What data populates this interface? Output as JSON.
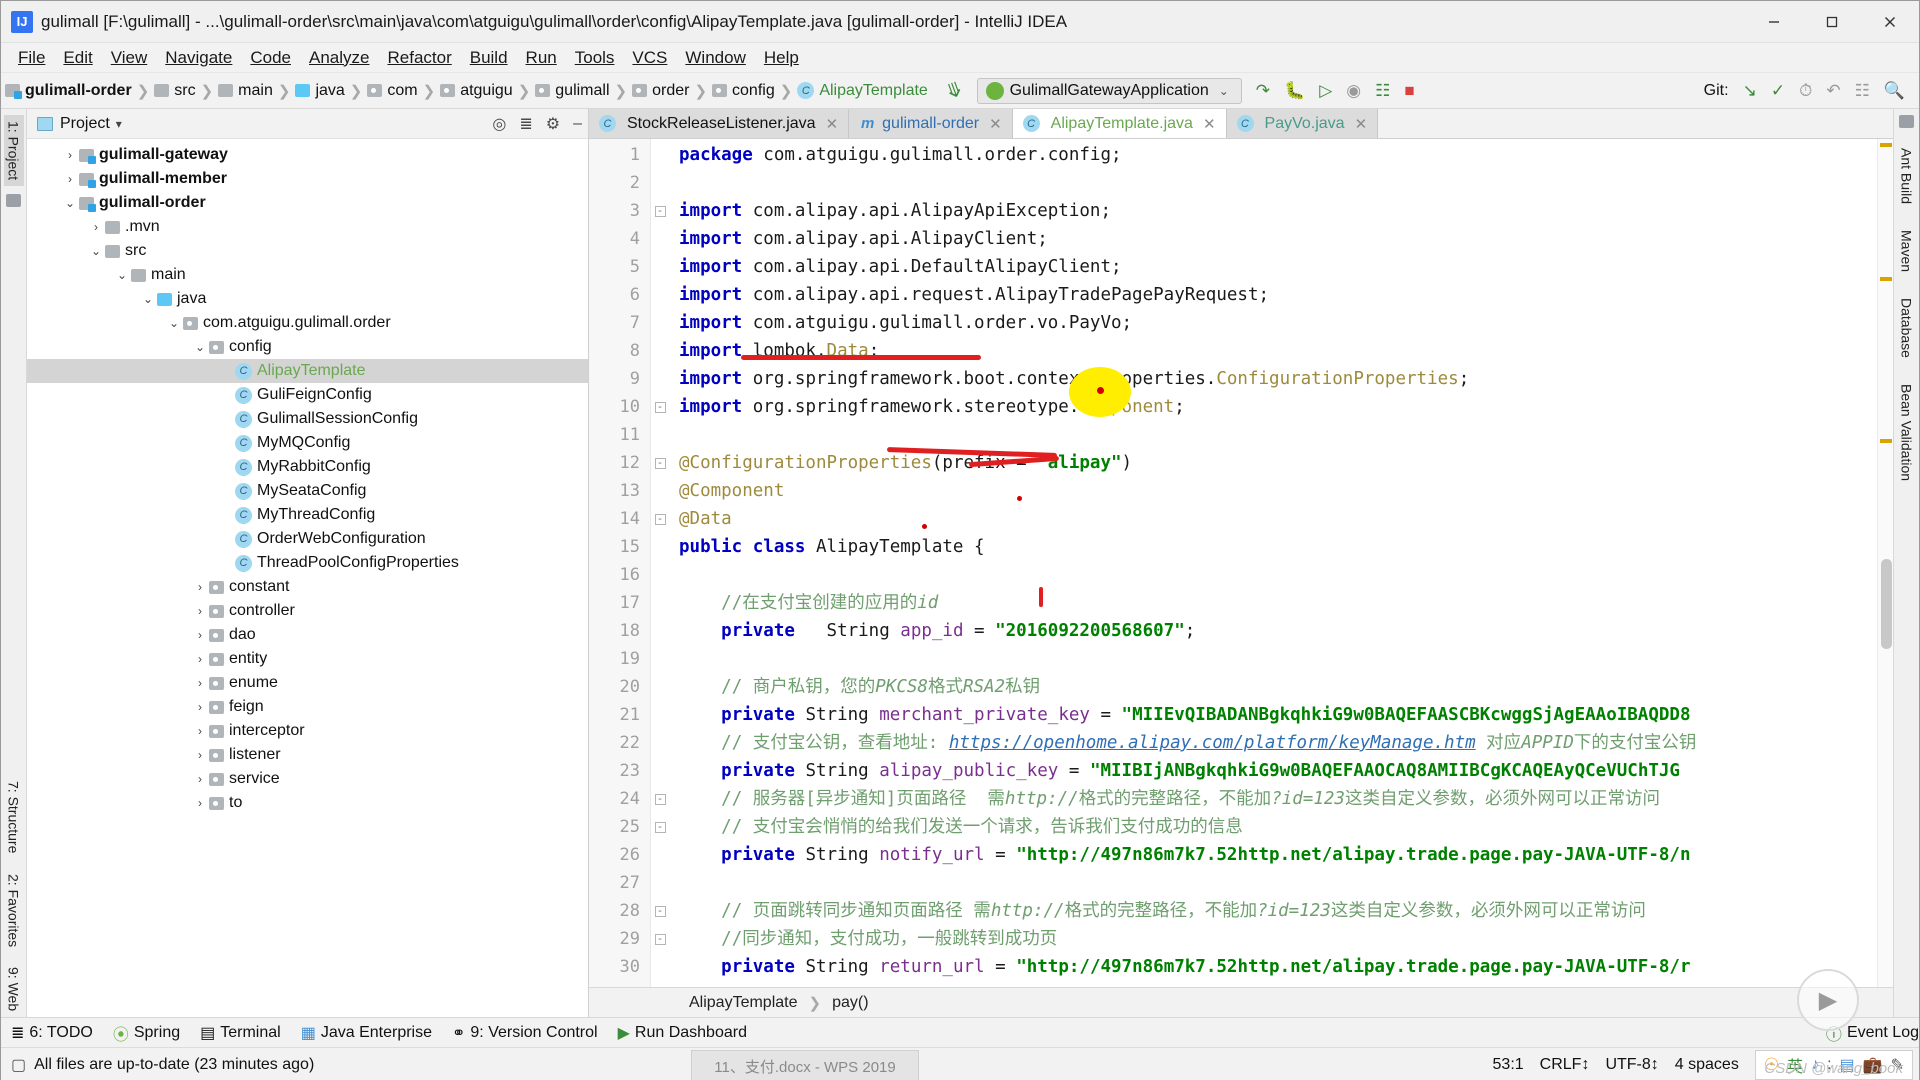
{
  "window": {
    "app_icon": "IJ",
    "title": "gulimall [F:\\gulimall] - ...\\gulimall-order\\src\\main\\java\\com\\atguigu\\gulimall\\order\\config\\AlipayTemplate.java [gulimall-order] - IntelliJ IDEA",
    "minimize": "—",
    "maximize": "❐",
    "close": "✕"
  },
  "menubar": [
    "File",
    "Edit",
    "View",
    "Navigate",
    "Code",
    "Analyze",
    "Refactor",
    "Build",
    "Run",
    "Tools",
    "VCS",
    "Window",
    "Help"
  ],
  "breadcrumb": [
    {
      "label": "gulimall-order",
      "icon": "module-folder-icon",
      "style": "bold"
    },
    {
      "label": "src",
      "icon": "folder-icon",
      "style": "plain"
    },
    {
      "label": "main",
      "icon": "folder-icon",
      "style": "plain"
    },
    {
      "label": "java",
      "icon": "source-folder-icon",
      "style": "plain"
    },
    {
      "label": "com",
      "icon": "package-icon",
      "style": "plain"
    },
    {
      "label": "atguigu",
      "icon": "package-icon",
      "style": "plain"
    },
    {
      "label": "gulimall",
      "icon": "package-icon",
      "style": "plain"
    },
    {
      "label": "order",
      "icon": "package-icon",
      "style": "plain"
    },
    {
      "label": "config",
      "icon": "package-icon",
      "style": "plain"
    },
    {
      "label": "AlipayTemplate",
      "icon": "class-icon",
      "style": "green"
    }
  ],
  "run_config": {
    "name": "GulimallGatewayApplication",
    "chevron": "⌄",
    "tools": [
      "rerun-icon",
      "debug-icon",
      "run-with-coverage-icon",
      "profiler-icon",
      "attach-debugger-icon",
      "stop-icon"
    ]
  },
  "git_section": {
    "label": "Git:",
    "icons": [
      "update-project-icon",
      "commit-icon",
      "history-icon",
      "rollback-icon",
      "ide-settings-icon",
      "search-everywhere-icon"
    ]
  },
  "left_strip": [
    {
      "label": "1: Project",
      "selected": true
    },
    {
      "label": "structure-tool-icon",
      "selected": false
    }
  ],
  "left_strip_bottom": [
    {
      "label": "7: Structure"
    },
    {
      "label": "2: Favorites"
    },
    {
      "label": "9: Web"
    }
  ],
  "right_strip": [
    "Ant Build",
    "Maven",
    "Database",
    "Bean Validation"
  ],
  "project_panel": {
    "title": "Project",
    "dropdown": "▾",
    "tools": [
      "locate-icon",
      "collapse-all-icon",
      "settings-icon",
      "hide-icon"
    ],
    "tree": [
      {
        "indent": 1,
        "chevron": "›",
        "icon": "module-folder-icon",
        "label": "gulimall-gateway",
        "bold": true,
        "selected": false
      },
      {
        "indent": 1,
        "chevron": "›",
        "icon": "module-folder-icon",
        "label": "gulimall-member",
        "bold": true,
        "selected": false
      },
      {
        "indent": 1,
        "chevron": "⌄",
        "icon": "module-folder-icon",
        "label": "gulimall-order",
        "bold": true,
        "selected": false
      },
      {
        "indent": 2,
        "chevron": "›",
        "icon": "folder-icon",
        "label": ".mvn",
        "bold": false,
        "selected": false
      },
      {
        "indent": 2,
        "chevron": "⌄",
        "icon": "folder-icon",
        "label": "src",
        "bold": false,
        "selected": false
      },
      {
        "indent": 3,
        "chevron": "⌄",
        "icon": "folder-icon",
        "label": "main",
        "bold": false,
        "selected": false
      },
      {
        "indent": 4,
        "chevron": "⌄",
        "icon": "source-folder-icon",
        "label": "java",
        "bold": false,
        "selected": false
      },
      {
        "indent": 5,
        "chevron": "⌄",
        "icon": "package-icon",
        "label": "com.atguigu.gulimall.order",
        "bold": false,
        "selected": false
      },
      {
        "indent": 6,
        "chevron": "⌄",
        "icon": "package-icon",
        "label": "config",
        "bold": false,
        "selected": false
      },
      {
        "indent": 7,
        "chevron": "",
        "icon": "class-icon",
        "label": "AlipayTemplate",
        "bold": false,
        "selected": true,
        "green": true
      },
      {
        "indent": 7,
        "chevron": "",
        "icon": "class-icon",
        "label": "GuliFeignConfig",
        "bold": false,
        "selected": false
      },
      {
        "indent": 7,
        "chevron": "",
        "icon": "class-icon",
        "label": "GulimallSessionConfig",
        "bold": false,
        "selected": false
      },
      {
        "indent": 7,
        "chevron": "",
        "icon": "class-icon",
        "label": "MyMQConfig",
        "bold": false,
        "selected": false
      },
      {
        "indent": 7,
        "chevron": "",
        "icon": "class-icon",
        "label": "MyRabbitConfig",
        "bold": false,
        "selected": false
      },
      {
        "indent": 7,
        "chevron": "",
        "icon": "class-icon",
        "label": "MySeataConfig",
        "bold": false,
        "selected": false
      },
      {
        "indent": 7,
        "chevron": "",
        "icon": "class-icon",
        "label": "MyThreadConfig",
        "bold": false,
        "selected": false
      },
      {
        "indent": 7,
        "chevron": "",
        "icon": "class-icon",
        "label": "OrderWebConfiguration",
        "bold": false,
        "selected": false
      },
      {
        "indent": 7,
        "chevron": "",
        "icon": "class-icon",
        "label": "ThreadPoolConfigProperties",
        "bold": false,
        "selected": false
      },
      {
        "indent": 6,
        "chevron": "›",
        "icon": "package-icon",
        "label": "constant",
        "bold": false,
        "selected": false
      },
      {
        "indent": 6,
        "chevron": "›",
        "icon": "package-icon",
        "label": "controller",
        "bold": false,
        "selected": false
      },
      {
        "indent": 6,
        "chevron": "›",
        "icon": "package-icon",
        "label": "dao",
        "bold": false,
        "selected": false
      },
      {
        "indent": 6,
        "chevron": "›",
        "icon": "package-icon",
        "label": "entity",
        "bold": false,
        "selected": false
      },
      {
        "indent": 6,
        "chevron": "›",
        "icon": "package-icon",
        "label": "enume",
        "bold": false,
        "selected": false
      },
      {
        "indent": 6,
        "chevron": "›",
        "icon": "package-icon",
        "label": "feign",
        "bold": false,
        "selected": false
      },
      {
        "indent": 6,
        "chevron": "›",
        "icon": "package-icon",
        "label": "interceptor",
        "bold": false,
        "selected": false
      },
      {
        "indent": 6,
        "chevron": "›",
        "icon": "package-icon",
        "label": "listener",
        "bold": false,
        "selected": false
      },
      {
        "indent": 6,
        "chevron": "›",
        "icon": "package-icon",
        "label": "service",
        "bold": false,
        "selected": false
      },
      {
        "indent": 6,
        "chevron": "›",
        "icon": "package-icon",
        "label": "to",
        "bold": false,
        "selected": false
      }
    ]
  },
  "editor_tabs": [
    {
      "label": "StockReleaseListener.java",
      "icon": "class-icon",
      "color": "plain",
      "active": false,
      "close": "✕"
    },
    {
      "label": "gulimall-order",
      "icon": "maven-icon",
      "color": "blue",
      "active": false,
      "close": "✕"
    },
    {
      "label": "AlipayTemplate.java",
      "icon": "class-icon",
      "color": "green",
      "active": true,
      "close": "✕"
    },
    {
      "label": "PayVo.java",
      "icon": "class-icon",
      "color": "teal",
      "active": false,
      "close": "✕"
    }
  ],
  "code": {
    "first_line_number": 1,
    "lines": [
      {
        "n": 1,
        "fold": "",
        "tokens": [
          {
            "t": "package ",
            "c": "kw"
          },
          {
            "t": "com.atguigu.gulimall.order.config;",
            "c": "pln"
          }
        ]
      },
      {
        "n": 2,
        "fold": "",
        "tokens": []
      },
      {
        "n": 3,
        "fold": "-",
        "tokens": [
          {
            "t": "import ",
            "c": "kw"
          },
          {
            "t": "com.alipay.api.AlipayApiException;",
            "c": "pln"
          }
        ]
      },
      {
        "n": 4,
        "fold": "",
        "tokens": [
          {
            "t": "import ",
            "c": "kw"
          },
          {
            "t": "com.alipay.api.AlipayClient;",
            "c": "pln"
          }
        ]
      },
      {
        "n": 5,
        "fold": "",
        "tokens": [
          {
            "t": "import ",
            "c": "kw"
          },
          {
            "t": "com.alipay.api.DefaultAlipayClient;",
            "c": "pln"
          }
        ]
      },
      {
        "n": 6,
        "fold": "",
        "tokens": [
          {
            "t": "import ",
            "c": "kw"
          },
          {
            "t": "com.alipay.api.request.AlipayTradePagePayRequest;",
            "c": "pln"
          }
        ]
      },
      {
        "n": 7,
        "fold": "",
        "tokens": [
          {
            "t": "import ",
            "c": "kw"
          },
          {
            "t": "com.atguigu.gulimall.order.vo.PayVo;",
            "c": "pln"
          }
        ]
      },
      {
        "n": 8,
        "fold": "",
        "tokens": [
          {
            "t": "import ",
            "c": "kw"
          },
          {
            "t": "lombok.",
            "c": "pln"
          },
          {
            "t": "Data",
            "c": "ann"
          },
          {
            "t": ";",
            "c": "pln"
          }
        ]
      },
      {
        "n": 9,
        "fold": "",
        "tokens": [
          {
            "t": "import ",
            "c": "kw"
          },
          {
            "t": "org.springframework.boot.context.properties.",
            "c": "pln"
          },
          {
            "t": "ConfigurationProperties",
            "c": "ann"
          },
          {
            "t": ";",
            "c": "pln"
          }
        ]
      },
      {
        "n": 10,
        "fold": "-",
        "tokens": [
          {
            "t": "import ",
            "c": "kw"
          },
          {
            "t": "org.springframework.stereotype.",
            "c": "pln"
          },
          {
            "t": "Component",
            "c": "ann"
          },
          {
            "t": ";",
            "c": "pln"
          }
        ]
      },
      {
        "n": 11,
        "fold": "",
        "tokens": []
      },
      {
        "n": 12,
        "fold": "-",
        "tokens": [
          {
            "t": "@ConfigurationProperties",
            "c": "ann"
          },
          {
            "t": "(prefix = ",
            "c": "pln"
          },
          {
            "t": "\"alipay\"",
            "c": "str"
          },
          {
            "t": ")",
            "c": "pln"
          }
        ]
      },
      {
        "n": 13,
        "fold": "",
        "tokens": [
          {
            "t": "@Component",
            "c": "ann"
          }
        ]
      },
      {
        "n": 14,
        "fold": "-",
        "tokens": [
          {
            "t": "@Data",
            "c": "ann"
          }
        ]
      },
      {
        "n": 15,
        "fold": "",
        "tokens": [
          {
            "t": "public class ",
            "c": "kw"
          },
          {
            "t": "AlipayTemplate ",
            "c": "typ"
          },
          {
            "t": "{",
            "c": "pln"
          }
        ]
      },
      {
        "n": 16,
        "fold": "",
        "tokens": []
      },
      {
        "n": 17,
        "fold": "",
        "tokens": [
          {
            "t": "    ",
            "c": "pln"
          },
          {
            "t": "//在支付宝创建的应用的",
            "c": "cmt-n"
          },
          {
            "t": "id",
            "c": "cmt"
          }
        ]
      },
      {
        "n": 18,
        "fold": "",
        "tokens": [
          {
            "t": "    ",
            "c": "pln"
          },
          {
            "t": "private",
            "c": "kw"
          },
          {
            "t": "   String ",
            "c": "pln"
          },
          {
            "t": "app_id",
            "c": "fld"
          },
          {
            "t": " = ",
            "c": "pln"
          },
          {
            "t": "\"2016092200568607\"",
            "c": "str"
          },
          {
            "t": ";",
            "c": "pln"
          }
        ]
      },
      {
        "n": 19,
        "fold": "",
        "tokens": []
      },
      {
        "n": 20,
        "fold": "",
        "tokens": [
          {
            "t": "    ",
            "c": "pln"
          },
          {
            "t": "// 商户私钥，您的",
            "c": "cmt-n"
          },
          {
            "t": "PKCS8",
            "c": "cmt"
          },
          {
            "t": "格式",
            "c": "cmt-n"
          },
          {
            "t": "RSA2",
            "c": "cmt"
          },
          {
            "t": "私钥",
            "c": "cmt-n"
          }
        ]
      },
      {
        "n": 21,
        "fold": "",
        "tokens": [
          {
            "t": "    ",
            "c": "pln"
          },
          {
            "t": "private",
            "c": "kw"
          },
          {
            "t": " String ",
            "c": "pln"
          },
          {
            "t": "merchant_private_key",
            "c": "fld"
          },
          {
            "t": " = ",
            "c": "pln"
          },
          {
            "t": "\"MIIEvQIBADANBgkqhkiG9w0BAQEFAASCBKcwggSjAgEAAoIBAQDD8",
            "c": "str"
          }
        ]
      },
      {
        "n": 22,
        "fold": "",
        "tokens": [
          {
            "t": "    ",
            "c": "pln"
          },
          {
            "t": "// 支付宝公钥，查看地址: ",
            "c": "cmt-n"
          },
          {
            "t": "https://openhome.alipay.com/platform/keyManage.htm",
            "c": "lnk"
          },
          {
            "t": " 对应",
            "c": "cmt-n"
          },
          {
            "t": "APPID",
            "c": "cmt"
          },
          {
            "t": "下的支付宝公钥",
            "c": "cmt-n"
          }
        ]
      },
      {
        "n": 23,
        "fold": "",
        "tokens": [
          {
            "t": "    ",
            "c": "pln"
          },
          {
            "t": "private",
            "c": "kw"
          },
          {
            "t": " String ",
            "c": "pln"
          },
          {
            "t": "alipay_public_key",
            "c": "fld"
          },
          {
            "t": " = ",
            "c": "pln"
          },
          {
            "t": "\"MIIBIjANBgkqhkiG9w0BAQEFAAOCAQ8AMIIBCgKCAQEAyQCeVUChTJG",
            "c": "str"
          }
        ]
      },
      {
        "n": 24,
        "fold": "-",
        "tokens": [
          {
            "t": "    ",
            "c": "pln"
          },
          {
            "t": "// 服务器[异步通知]页面路径  需",
            "c": "cmt-n"
          },
          {
            "t": "http://",
            "c": "cmt"
          },
          {
            "t": "格式的完整路径，不能加",
            "c": "cmt-n"
          },
          {
            "t": "?id=123",
            "c": "cmt"
          },
          {
            "t": "这类自定义参数，必须外网可以正常访问",
            "c": "cmt-n"
          }
        ]
      },
      {
        "n": 25,
        "fold": "-",
        "tokens": [
          {
            "t": "    ",
            "c": "pln"
          },
          {
            "t": "// 支付宝会悄悄的给我们发送一个请求，告诉我们支付成功的信息",
            "c": "cmt-n"
          }
        ]
      },
      {
        "n": 26,
        "fold": "",
        "tokens": [
          {
            "t": "    ",
            "c": "pln"
          },
          {
            "t": "private",
            "c": "kw"
          },
          {
            "t": " String ",
            "c": "pln"
          },
          {
            "t": "notify_url",
            "c": "fld"
          },
          {
            "t": " = ",
            "c": "pln"
          },
          {
            "t": "\"http://497n86m7k7.52http.net/alipay.trade.page.pay-JAVA-UTF-8/n",
            "c": "str"
          }
        ]
      },
      {
        "n": 27,
        "fold": "",
        "tokens": []
      },
      {
        "n": 28,
        "fold": "-",
        "tokens": [
          {
            "t": "    ",
            "c": "pln"
          },
          {
            "t": "// 页面跳转同步通知页面路径 需",
            "c": "cmt-n"
          },
          {
            "t": "http://",
            "c": "cmt"
          },
          {
            "t": "格式的完整路径，不能加",
            "c": "cmt-n"
          },
          {
            "t": "?id=123",
            "c": "cmt"
          },
          {
            "t": "这类自定义参数，必须外网可以正常访问",
            "c": "cmt-n"
          }
        ]
      },
      {
        "n": 29,
        "fold": "-",
        "tokens": [
          {
            "t": "    ",
            "c": "pln"
          },
          {
            "t": "//同步通知，支付成功，一般跳转到成功页",
            "c": "cmt-n"
          }
        ]
      },
      {
        "n": 30,
        "fold": "",
        "tokens": [
          {
            "t": "    ",
            "c": "pln"
          },
          {
            "t": "private",
            "c": "kw"
          },
          {
            "t": " String ",
            "c": "pln"
          },
          {
            "t": "return_url",
            "c": "fld"
          },
          {
            "t": " = ",
            "c": "pln"
          },
          {
            "t": "\"http://497n86m7k7.52http.net/alipay.trade.page.pay-JAVA-UTF-8/r",
            "c": "str"
          }
        ]
      }
    ]
  },
  "editor_breadcrumb": [
    {
      "label": "AlipayTemplate"
    },
    {
      "label": "pay()"
    }
  ],
  "bottom_toolwindows": [
    {
      "label": "6: TODO",
      "icon": "todo-icon"
    },
    {
      "label": "Spring",
      "icon": "spring-icon"
    },
    {
      "label": "Terminal",
      "icon": "terminal-icon"
    },
    {
      "label": "Java Enterprise",
      "icon": "java-enterprise-icon"
    },
    {
      "label": "9: Version Control",
      "icon": "version-control-icon"
    },
    {
      "label": "Run Dashboard",
      "icon": "run-dashboard-icon"
    }
  ],
  "event_log": {
    "label": "Event Log",
    "icon": "event-log-icon"
  },
  "statusbar": {
    "message": "All files are up-to-date (23 minutes ago)",
    "taskbar_button": "11、支付.docx - WPS 2019",
    "caret": "53:1",
    "line_sep": "CRLF",
    "line_sep_chevron": "↕",
    "encoding": "UTF-8",
    "encoding_chevron": "↕",
    "indent": "4 spaces",
    "ime": {
      "logo": "sogou-icon",
      "mode": "英",
      "items": [
        "moon-icon",
        "colon-icon",
        "keyboard-icon",
        "toolbox-icon",
        "tools-icon"
      ]
    }
  },
  "watermark": "CSDN @wang_book",
  "colors": {
    "accent_green": "#3b8c3b",
    "keyword_blue": "#0000c0",
    "string_green": "#008000",
    "annotation_gold": "#9e8a3c",
    "comment_green": "#6f9e6f",
    "marker_red": "#e02020",
    "highlighter_yellow": "#ffee00",
    "selection_gray": "#d4d4d4"
  }
}
